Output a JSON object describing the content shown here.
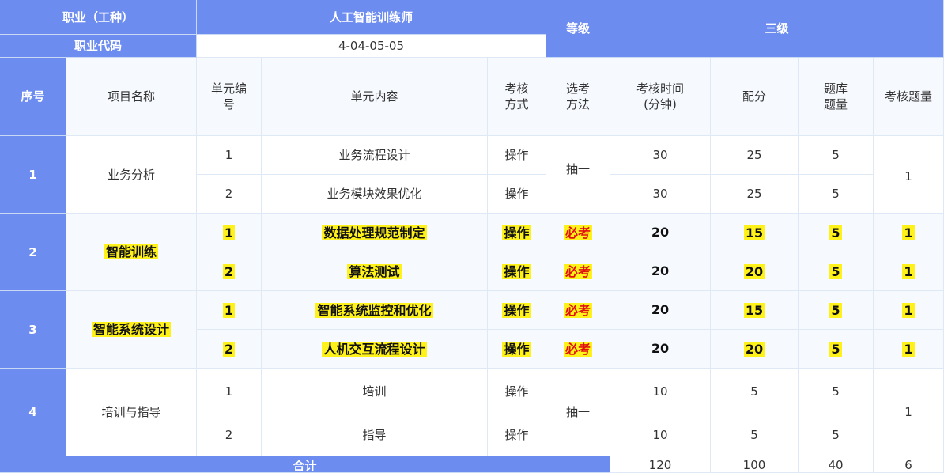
{
  "title_row": {
    "occupation_label": "职业（工种）",
    "occupation_value": "人工智能训练师",
    "level_label": "等级",
    "level_value": "三级",
    "code_label": "职业代码",
    "code_value": "4-04-05-05"
  },
  "headers": {
    "seq": "序号",
    "project_name": "项目名称",
    "unit_no": "单元编\n号",
    "unit_content": "单元内容",
    "assess_mode": "考核\n方式",
    "select_method": "选考\n方法",
    "assess_time": "考核时间\n(分钟)",
    "score": "配分",
    "bank_count": "题库\n题量",
    "exam_count": "考核题量"
  },
  "projects": [
    {
      "seq": "1",
      "name": "业务分析",
      "select_method": "抽一",
      "exam_count": "1",
      "highlighted": false,
      "units": [
        {
          "no": "1",
          "content": "业务流程设计",
          "mode": "操作",
          "time": "30",
          "score": "25",
          "bank": "5"
        },
        {
          "no": "2",
          "content": "业务模块效果优化",
          "mode": "操作",
          "time": "30",
          "score": "25",
          "bank": "5"
        }
      ]
    },
    {
      "seq": "2",
      "name": "智能训练",
      "select_method": "必考",
      "highlighted": true,
      "units": [
        {
          "no": "1",
          "content": "数据处理规范制定",
          "mode": "操作",
          "method": "必考",
          "time": "20",
          "score": "15",
          "bank": "5",
          "exam": "1"
        },
        {
          "no": "2",
          "content": "算法测试",
          "mode": "操作",
          "method": "必考",
          "time": "20",
          "score": "20",
          "bank": "5",
          "exam": "1"
        }
      ]
    },
    {
      "seq": "3",
      "name": "智能系统设计",
      "select_method": "必考",
      "highlighted": true,
      "units": [
        {
          "no": "1",
          "content": "智能系统监控和优化",
          "mode": "操作",
          "method": "必考",
          "time": "20",
          "score": "15",
          "bank": "5",
          "exam": "1"
        },
        {
          "no": "2",
          "content": "人机交互流程设计",
          "mode": "操作",
          "method": "必考",
          "time": "20",
          "score": "20",
          "bank": "5",
          "exam": "1"
        }
      ]
    },
    {
      "seq": "4",
      "name": "培训与指导",
      "select_method": "抽一",
      "exam_count": "1",
      "highlighted": false,
      "units": [
        {
          "no": "1",
          "content": "培训",
          "mode": "操作",
          "time": "10",
          "score": "5",
          "bank": "5"
        },
        {
          "no": "2",
          "content": "指导",
          "mode": "操作",
          "time": "10",
          "score": "5",
          "bank": "5"
        }
      ]
    }
  ],
  "totals": {
    "label": "合计",
    "time": "120",
    "score": "100",
    "bank": "40",
    "exam": "6"
  },
  "colors": {
    "header_blue": "#6d8cf0",
    "highlight": "#fff21a",
    "required_red": "#e01010"
  }
}
